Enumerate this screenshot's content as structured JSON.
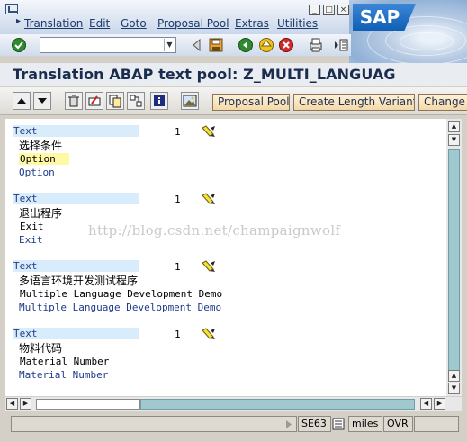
{
  "menu": {
    "items": [
      "Translation",
      "Edit",
      "Goto",
      "Proposal Pool",
      "Extras",
      "Utilities"
    ]
  },
  "window_buttons": {
    "minimize": "_",
    "restore": "□",
    "close": "×"
  },
  "logo": {
    "text": "SAP"
  },
  "command_field": {
    "value": ""
  },
  "page_title": "Translation ABAP text pool: Z_MULTI_LANGUAG",
  "app_toolbar": {
    "proposal_pool": "Proposal Pool",
    "create_length_variant": "Create Length Variant",
    "change": "Change"
  },
  "watermark": "http://blog.csdn.net/champaignwolf",
  "entries": [
    {
      "type": "Text",
      "count": "1",
      "source": "选择条件",
      "original": "Option",
      "translation": "Option"
    },
    {
      "type": "Text",
      "count": "1",
      "source": "退出程序",
      "original": "Exit",
      "translation": "Exit"
    },
    {
      "type": "Text",
      "count": "1",
      "source": "多语言环境开发测试程序",
      "original": "Multiple Language Development Demo",
      "translation": "Multiple Language Development Demo"
    },
    {
      "type": "Text",
      "count": "1",
      "source": "物料代码",
      "original": "Material Number",
      "translation": "Material Number"
    }
  ],
  "status": {
    "transaction": "SE63",
    "server": "miles",
    "mode": "OVR"
  },
  "colors": {
    "header_bg": "#d8ecfb",
    "text_blue": "#1f3c8a",
    "highlight_yellow": "#fff9a6",
    "button_bg": "#f4d9a8",
    "scroll_thumb": "#9fc9cf"
  }
}
